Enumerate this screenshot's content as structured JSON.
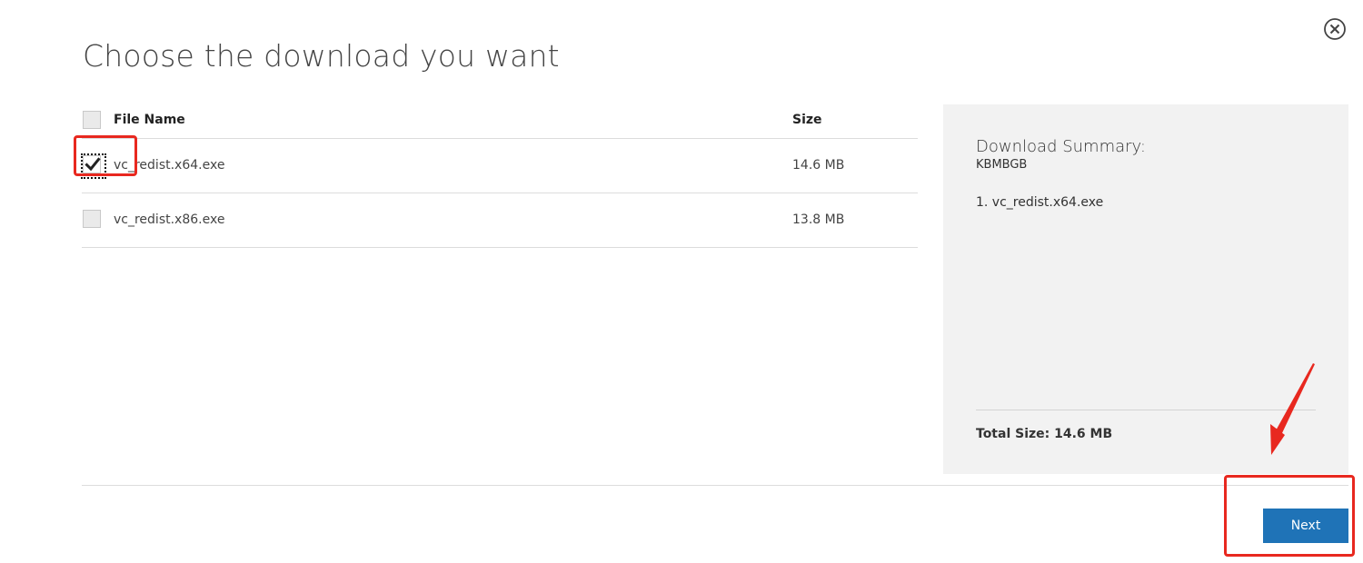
{
  "dialog": {
    "title": "Choose the download you want"
  },
  "table": {
    "headers": {
      "name": "File Name",
      "size": "Size"
    },
    "rows": [
      {
        "name": "vc_redist.x64.exe",
        "size": "14.6 MB",
        "checked": true
      },
      {
        "name": "vc_redist.x86.exe",
        "size": "13.8 MB",
        "checked": false
      }
    ]
  },
  "summary": {
    "title": "Download Summary:",
    "subtitle": "KBMBGB",
    "items": [
      "1. vc_redist.x64.exe"
    ],
    "total": "Total Size: 14.6 MB"
  },
  "actions": {
    "next_label": "Next"
  },
  "icons": {
    "close": "close-icon",
    "checkmark": "checkmark-icon"
  },
  "colors": {
    "primary_button": "#1f73b7",
    "annotation": "#e8281f",
    "summary_bg": "#f2f2f2"
  }
}
